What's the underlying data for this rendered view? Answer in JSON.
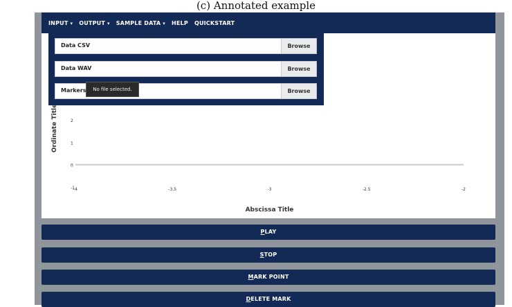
{
  "caption": "(c) Annotated example",
  "nav": {
    "items": [
      {
        "label": "INPUT",
        "dropdown": true
      },
      {
        "label": "OUTPUT",
        "dropdown": true
      },
      {
        "label": "SAMPLE DATA",
        "dropdown": true
      },
      {
        "label": "HELP",
        "dropdown": false
      },
      {
        "label": "QUICKSTART",
        "dropdown": false
      }
    ],
    "caret": "▾"
  },
  "input_menu": {
    "rows": [
      {
        "label": "Data CSV",
        "button": "Browse"
      },
      {
        "label": "Data WAV",
        "button": "Browse"
      },
      {
        "label": "Markers",
        "button": "Browse"
      }
    ],
    "tooltip": "No file selected."
  },
  "chart_data": {
    "type": "line",
    "xlabel": "Abscissa Title",
    "ylabel": "Ordinate Title",
    "x_ticks": [
      -4,
      -3.5,
      -3,
      -2.5,
      -2
    ],
    "x_tick_labels": [
      "-4",
      "-3.5",
      "-3",
      "-2.5",
      "-2"
    ],
    "y_ticks": [
      -1,
      0,
      1,
      2
    ],
    "y_tick_labels": [
      "-1",
      "0",
      "1",
      "2"
    ],
    "xlim": [
      -4,
      -2
    ],
    "ylim": [
      -1,
      2
    ],
    "series": [
      {
        "x": [
          -4,
          -2
        ],
        "y": [
          0,
          0
        ]
      }
    ],
    "colors": {
      "line": "#c8cacc",
      "text": "#333333"
    }
  },
  "controls": {
    "play": {
      "accel": "P",
      "rest": "LAY"
    },
    "stop": {
      "accel": "S",
      "rest": "TOP"
    },
    "mark": {
      "accel": "M",
      "rest": "ARK POINT"
    },
    "delete": {
      "accel": "D",
      "rest": "ELETE MARK"
    }
  }
}
